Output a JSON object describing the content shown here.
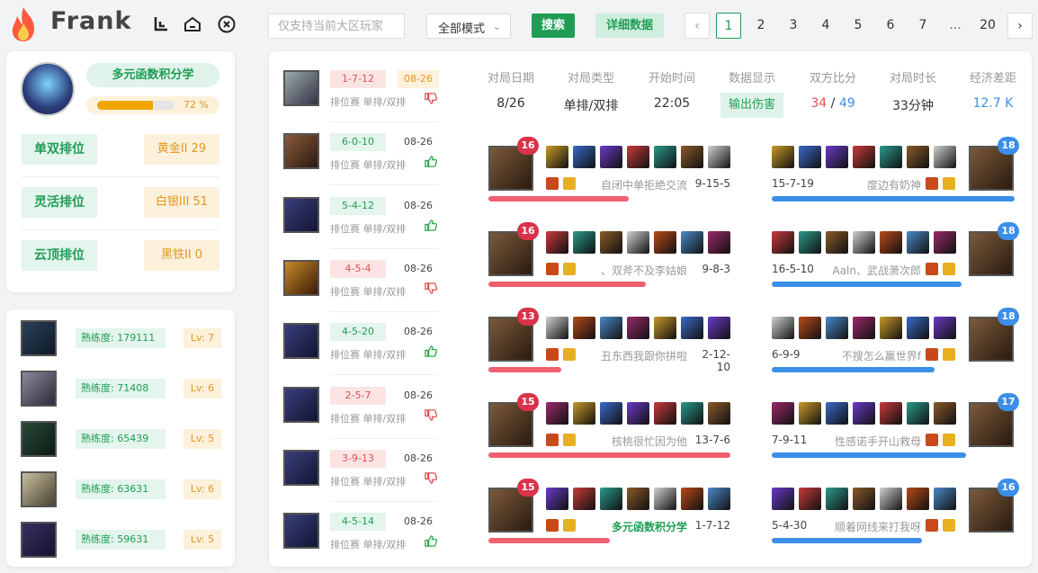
{
  "brand": "Frank",
  "search": {
    "placeholder": "仅支持当前大区玩家",
    "mode": "全部模式",
    "search_label": "搜索",
    "detail_label": "详细数据"
  },
  "pagination": {
    "prev": "‹",
    "pages": [
      "1",
      "2",
      "3",
      "4",
      "5",
      "6",
      "7",
      "...",
      "20"
    ],
    "next": "›",
    "current": "1"
  },
  "profile": {
    "name": "多元函数积分学",
    "level_progress": 72,
    "level_text": "72 %",
    "ranks": [
      {
        "label": "单双排位",
        "value": "黄金II 29"
      },
      {
        "label": "灵活排位",
        "value": "白银III 51"
      },
      {
        "label": "云顶排位",
        "value": "黑铁II 0"
      }
    ]
  },
  "champions": [
    {
      "proficiency": "熟练度: 179111",
      "level": "Lv: 7"
    },
    {
      "proficiency": "熟练度: 71408",
      "level": "Lv: 6"
    },
    {
      "proficiency": "熟练度: 65439",
      "level": "Lv: 5"
    },
    {
      "proficiency": "熟练度: 63631",
      "level": "Lv: 6"
    },
    {
      "proficiency": "熟练度: 59631",
      "level": "Lv: 5"
    }
  ],
  "matches": [
    {
      "kda": "1-7-12",
      "date": "08-26",
      "type": "排位赛 单排/双排",
      "result": "loss",
      "highlight": true
    },
    {
      "kda": "6-0-10",
      "date": "08-26",
      "type": "排位赛 单排/双排",
      "result": "win",
      "highlight": false
    },
    {
      "kda": "5-4-12",
      "date": "08-26",
      "type": "排位赛 单排/双排",
      "result": "win",
      "highlight": false
    },
    {
      "kda": "4-5-4",
      "date": "08-26",
      "type": "排位赛 单排/双排",
      "result": "loss",
      "highlight": false
    },
    {
      "kda": "4-5-20",
      "date": "08-26",
      "type": "排位赛 单排/双排",
      "result": "win",
      "highlight": false
    },
    {
      "kda": "2-5-7",
      "date": "08-26",
      "type": "排位赛 单排/双排",
      "result": "loss",
      "highlight": false
    },
    {
      "kda": "3-9-13",
      "date": "08-26",
      "type": "排位赛 单排/双排",
      "result": "loss",
      "highlight": false
    },
    {
      "kda": "4-5-14",
      "date": "08-26",
      "type": "排位赛 单排/双排",
      "result": "win",
      "highlight": false
    }
  ],
  "stats": {
    "headers": [
      "对局日期",
      "对局类型",
      "开始时间",
      "数据显示",
      "双方比分",
      "对局时长",
      "经济差距"
    ],
    "date": "8/26",
    "type": "单排/双排",
    "start": "22:05",
    "display": "输出伤害",
    "score_red": "34",
    "score_sep": " / ",
    "score_blue": "49",
    "duration": "33分钟",
    "gold_diff": "12.7 K"
  },
  "red_team": [
    {
      "level": "16",
      "name": "自闭中单拒绝交流",
      "kda": "9-15-5",
      "damage": 0.58
    },
    {
      "level": "16",
      "name": "、双斧不及李姑娘",
      "kda": "9-8-3",
      "damage": 0.65
    },
    {
      "level": "13",
      "name": "丑东西我跟你拼啦",
      "kda": "2-12-10",
      "damage": 0.3
    },
    {
      "level": "15",
      "name": "核桃很忙因为他",
      "kda": "13-7-6",
      "damage": 1.0
    },
    {
      "level": "15",
      "name": "多元函数积分学",
      "kda": "1-7-12",
      "damage": 0.5,
      "me": true
    }
  ],
  "blue_team": [
    {
      "level": "18",
      "name": "度边有奶神",
      "kda": "15-7-19",
      "damage": 1.0
    },
    {
      "level": "18",
      "name": "Aaln、武战萧次郎",
      "kda": "16-5-10",
      "damage": 0.78
    },
    {
      "level": "18",
      "name": "不搜怎么赢世界f",
      "kda": "6-9-9",
      "damage": 0.67
    },
    {
      "level": "17",
      "name": "性感诺手开山救母",
      "kda": "7-9-11",
      "damage": 0.8
    },
    {
      "level": "16",
      "name": "顺着网线来打我呀",
      "kda": "5-4-30",
      "damage": 0.62
    }
  ],
  "colors": {
    "green": "#1f9d55",
    "red": "#e05050",
    "blue": "#3b8fe8",
    "orange": "#e5961f"
  },
  "icons": [
    "fire-logo-icon",
    "collapse-icon",
    "home-icon",
    "close-icon",
    "chevron-down-icon",
    "thumb-up-icon",
    "thumb-down-icon"
  ]
}
